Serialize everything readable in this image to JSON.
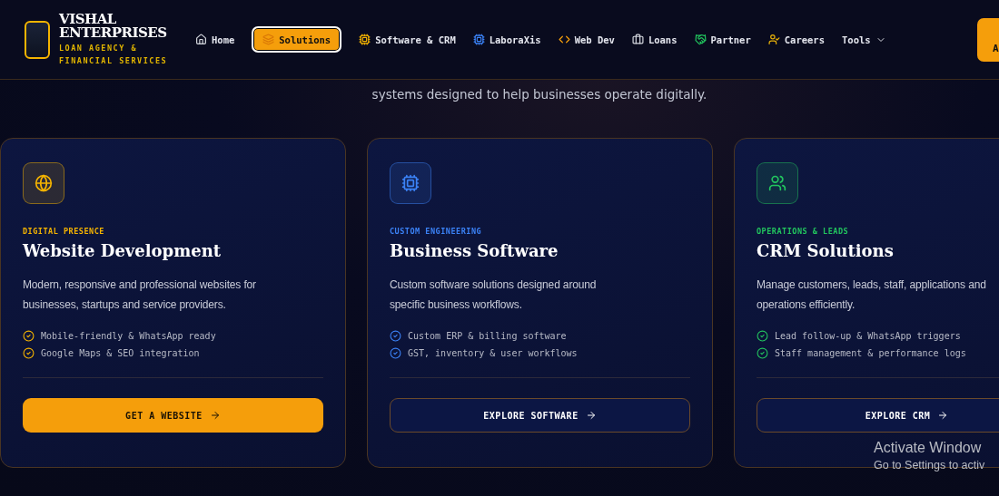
{
  "brand": {
    "name": "VISHAL ENTERPRISES",
    "tagline": "LOAN AGENCY & FINANCIAL SERVICES"
  },
  "nav": [
    {
      "label": "Home",
      "selected": false
    },
    {
      "label": "Solutions",
      "selected": true
    },
    {
      "label": "Software & CRM",
      "selected": false
    },
    {
      "label": "LaboraXis",
      "selected": false
    },
    {
      "label": "Web Dev",
      "selected": false
    },
    {
      "label": "Loans",
      "selected": false
    },
    {
      "label": "Partner",
      "selected": false
    },
    {
      "label": "Careers",
      "selected": false
    },
    {
      "label": "Tools",
      "selected": false
    }
  ],
  "header_button": "A",
  "intro": "systems designed to help businesses operate digitally.",
  "cards": [
    {
      "eyebrow": "DIGITAL PRESENCE",
      "title": "Website Development",
      "description": "Modern, responsive and professional websites for businesses, startups and service providers.",
      "color": "#f5b400",
      "features": [
        "Mobile-friendly & WhatsApp ready",
        "Google Maps & SEO integration"
      ],
      "button": {
        "label": "GET A WEBSITE",
        "kind": "filled"
      }
    },
    {
      "eyebrow": "CUSTOM ENGINEERING",
      "title": "Business Software",
      "description": "Custom software solutions designed around specific business workflows.",
      "color": "#3b82f6",
      "features": [
        "Custom ERP & billing software",
        "GST, inventory & user workflows"
      ],
      "button": {
        "label": "EXPLORE SOFTWARE",
        "kind": "outline"
      }
    },
    {
      "eyebrow": "OPERATIONS & LEADS",
      "title": "CRM Solutions",
      "description": "Manage customers, leads, staff, applications and operations efficiently.",
      "color": "#22c55e",
      "features": [
        "Lead follow-up & WhatsApp triggers",
        "Staff management & performance logs"
      ],
      "button": {
        "label": "EXPLORE CRM",
        "kind": "outline"
      }
    }
  ],
  "os_overlay": {
    "title": "Activate Window",
    "subtitle": "Go to Settings to activ"
  }
}
